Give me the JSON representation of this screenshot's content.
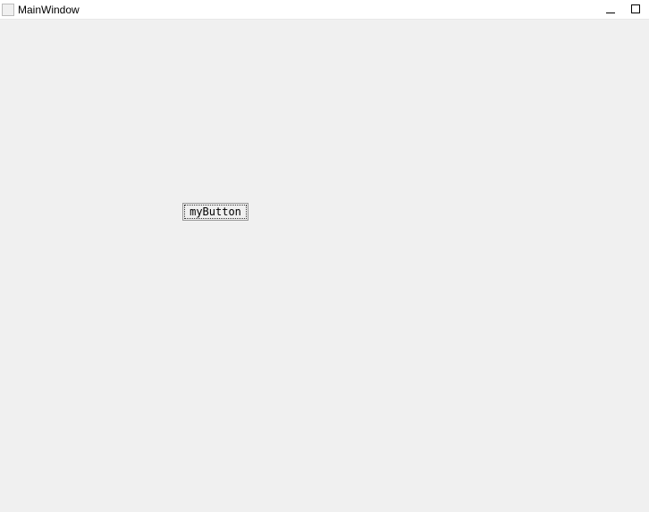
{
  "window": {
    "title": "MainWindow"
  },
  "main": {
    "button_label": "myButton"
  }
}
